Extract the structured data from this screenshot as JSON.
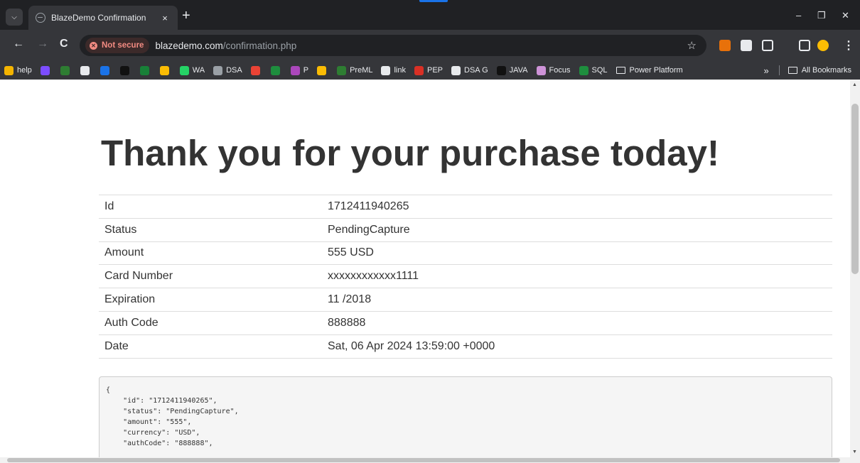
{
  "browser": {
    "tab_title": "BlazeDemo Confirmation",
    "tab_close": "×",
    "new_tab": "+",
    "minimize": "–",
    "restore": "❐",
    "close": "✕",
    "back": "←",
    "forward": "→",
    "reload": "C",
    "security_label": "Not secure",
    "url_host": "blazedemo.com",
    "url_path": "/confirmation.php",
    "star": "☆",
    "menu": "⋮"
  },
  "bookmarks": {
    "items": [
      {
        "label": "help",
        "color": "#f4b400"
      },
      {
        "label": "",
        "color": "#7c4dff"
      },
      {
        "label": "",
        "color": "#2e7d32"
      },
      {
        "label": "",
        "color": "#e8eaed"
      },
      {
        "label": "",
        "color": "#1a73e8"
      },
      {
        "label": "",
        "color": "#111111"
      },
      {
        "label": "",
        "color": "#188038"
      },
      {
        "label": "",
        "color": "#fbbc04"
      },
      {
        "label": "WA",
        "color": "#25d366"
      },
      {
        "label": "DSA",
        "color": "#9aa0a6"
      },
      {
        "label": "",
        "color": "#ea4335"
      },
      {
        "label": "",
        "color": "#1e8e3e"
      },
      {
        "label": "P",
        "color": "#ab47bc"
      },
      {
        "label": "",
        "color": "#fbbc04"
      },
      {
        "label": "PreML",
        "color": "#2e7d32"
      },
      {
        "label": "link",
        "color": "#e8eaed"
      },
      {
        "label": "PEP",
        "color": "#d93025"
      },
      {
        "label": "DSA G",
        "color": "#e8eaed"
      },
      {
        "label": "JAVA",
        "color": "#111111"
      },
      {
        "label": "Focus",
        "color": "#ce93d8"
      },
      {
        "label": "SQL",
        "color": "#1e8e3e"
      },
      {
        "label": "Power Platform",
        "color": ""
      }
    ],
    "overflow": "»",
    "all_bookmarks": "All Bookmarks"
  },
  "page": {
    "heading": "Thank you for your purchase today!",
    "rows": [
      {
        "key": "Id",
        "value": "1712411940265"
      },
      {
        "key": "Status",
        "value": "PendingCapture"
      },
      {
        "key": "Amount",
        "value": "555 USD"
      },
      {
        "key": "Card Number",
        "value": "xxxxxxxxxxxx1111"
      },
      {
        "key": "Expiration",
        "value": "11 /2018"
      },
      {
        "key": "Auth Code",
        "value": "888888"
      },
      {
        "key": "Date",
        "value": "Sat, 06 Apr 2024 13:59:00 +0000"
      }
    ],
    "json_text": "{\n    \"id\": \"1712411940265\",\n    \"status\": \"PendingCapture\",\n    \"amount\": \"555\",\n    \"currency\": \"USD\",\n    \"authCode\": \"888888\","
  }
}
